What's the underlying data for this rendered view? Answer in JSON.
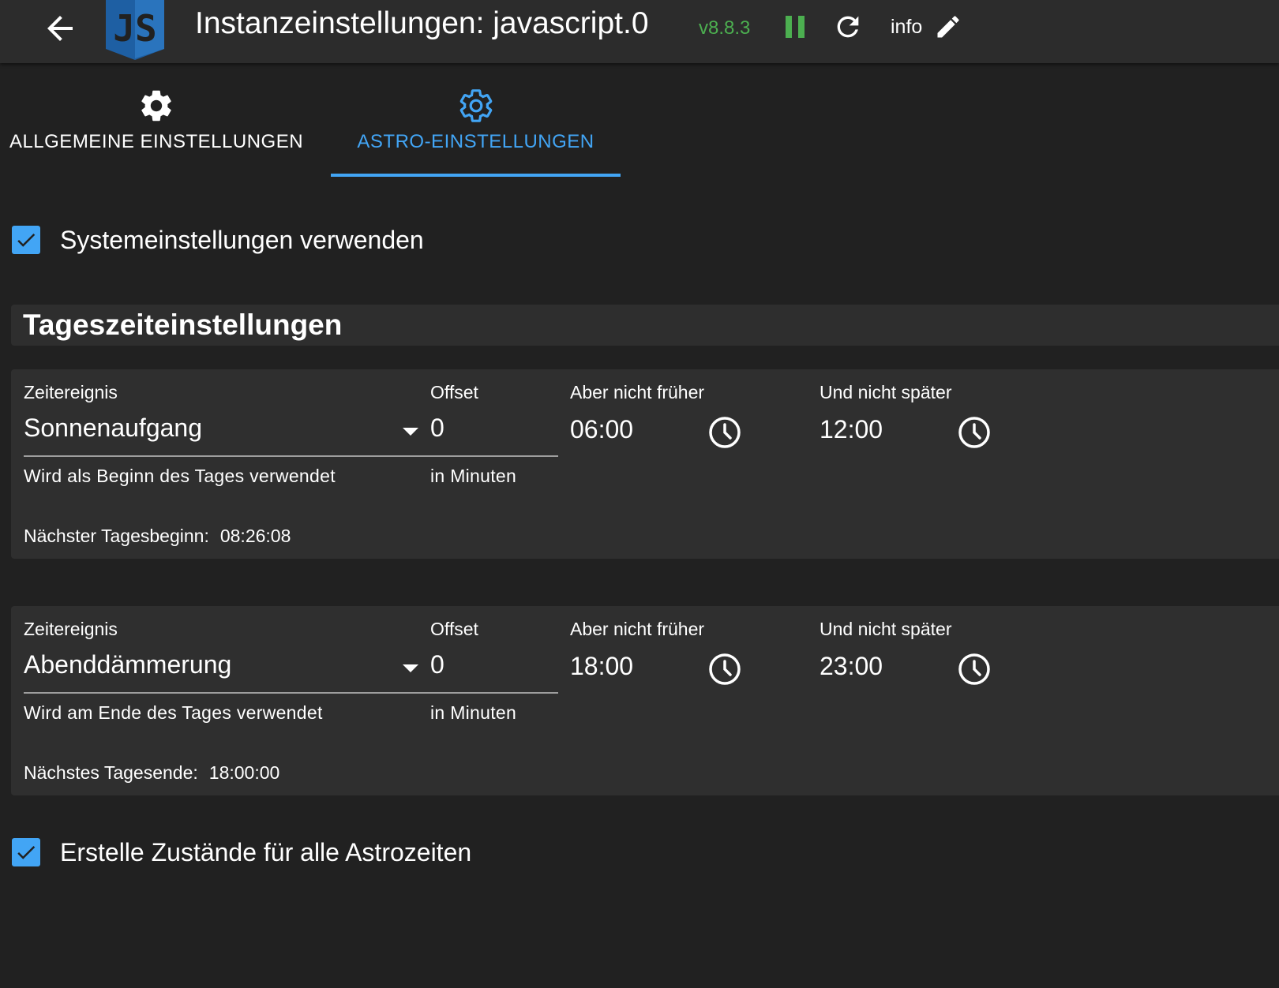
{
  "header": {
    "logo_text": "JS",
    "title": "Instanzeinstellungen: javascript.0",
    "version": "v8.8.3",
    "info_label": "info"
  },
  "tabs": [
    {
      "label": "ALLGEMEINE EINSTELLUNGEN",
      "icon": "gear-icon",
      "active": false
    },
    {
      "label": "ASTRO-EINSTELLUNGEN",
      "icon": "gear-outline-icon",
      "active": true
    }
  ],
  "use_system_settings": {
    "label": "Systemeinstellungen verwenden",
    "checked": true
  },
  "section": {
    "title": "Tageszeiteinstellungen"
  },
  "day_start": {
    "event_label": "Zeitereignis",
    "event_value": "Sonnenaufgang",
    "event_helper": "Wird als Beginn des Tages verwendet",
    "offset_label": "Offset",
    "offset_value": "0",
    "offset_helper": "in Minuten",
    "not_before_label": "Aber nicht früher",
    "not_before_value": "06:00",
    "not_after_label": "Und nicht später",
    "not_after_value": "12:00",
    "next_label": "Nächster Tagesbeginn:",
    "next_value": "08:26:08"
  },
  "day_end": {
    "event_label": "Zeitereignis",
    "event_value": "Abenddämmerung",
    "event_helper": "Wird am Ende des Tages verwendet",
    "offset_label": "Offset",
    "offset_value": "0",
    "offset_helper": "in Minuten",
    "not_before_label": "Aber nicht früher",
    "not_before_value": "18:00",
    "not_after_label": "Und nicht später",
    "not_after_value": "23:00",
    "next_label": "Nächstes Tagesende:",
    "next_value": "18:00:00"
  },
  "create_states": {
    "label": "Erstelle Zustände für alle Astrozeiten",
    "checked": true
  },
  "colors": {
    "accent": "#42a5f5",
    "version_green": "#4caf50",
    "background": "#212121",
    "header_bg": "#2c2c2c",
    "card_bg": "#2f2f2f"
  }
}
